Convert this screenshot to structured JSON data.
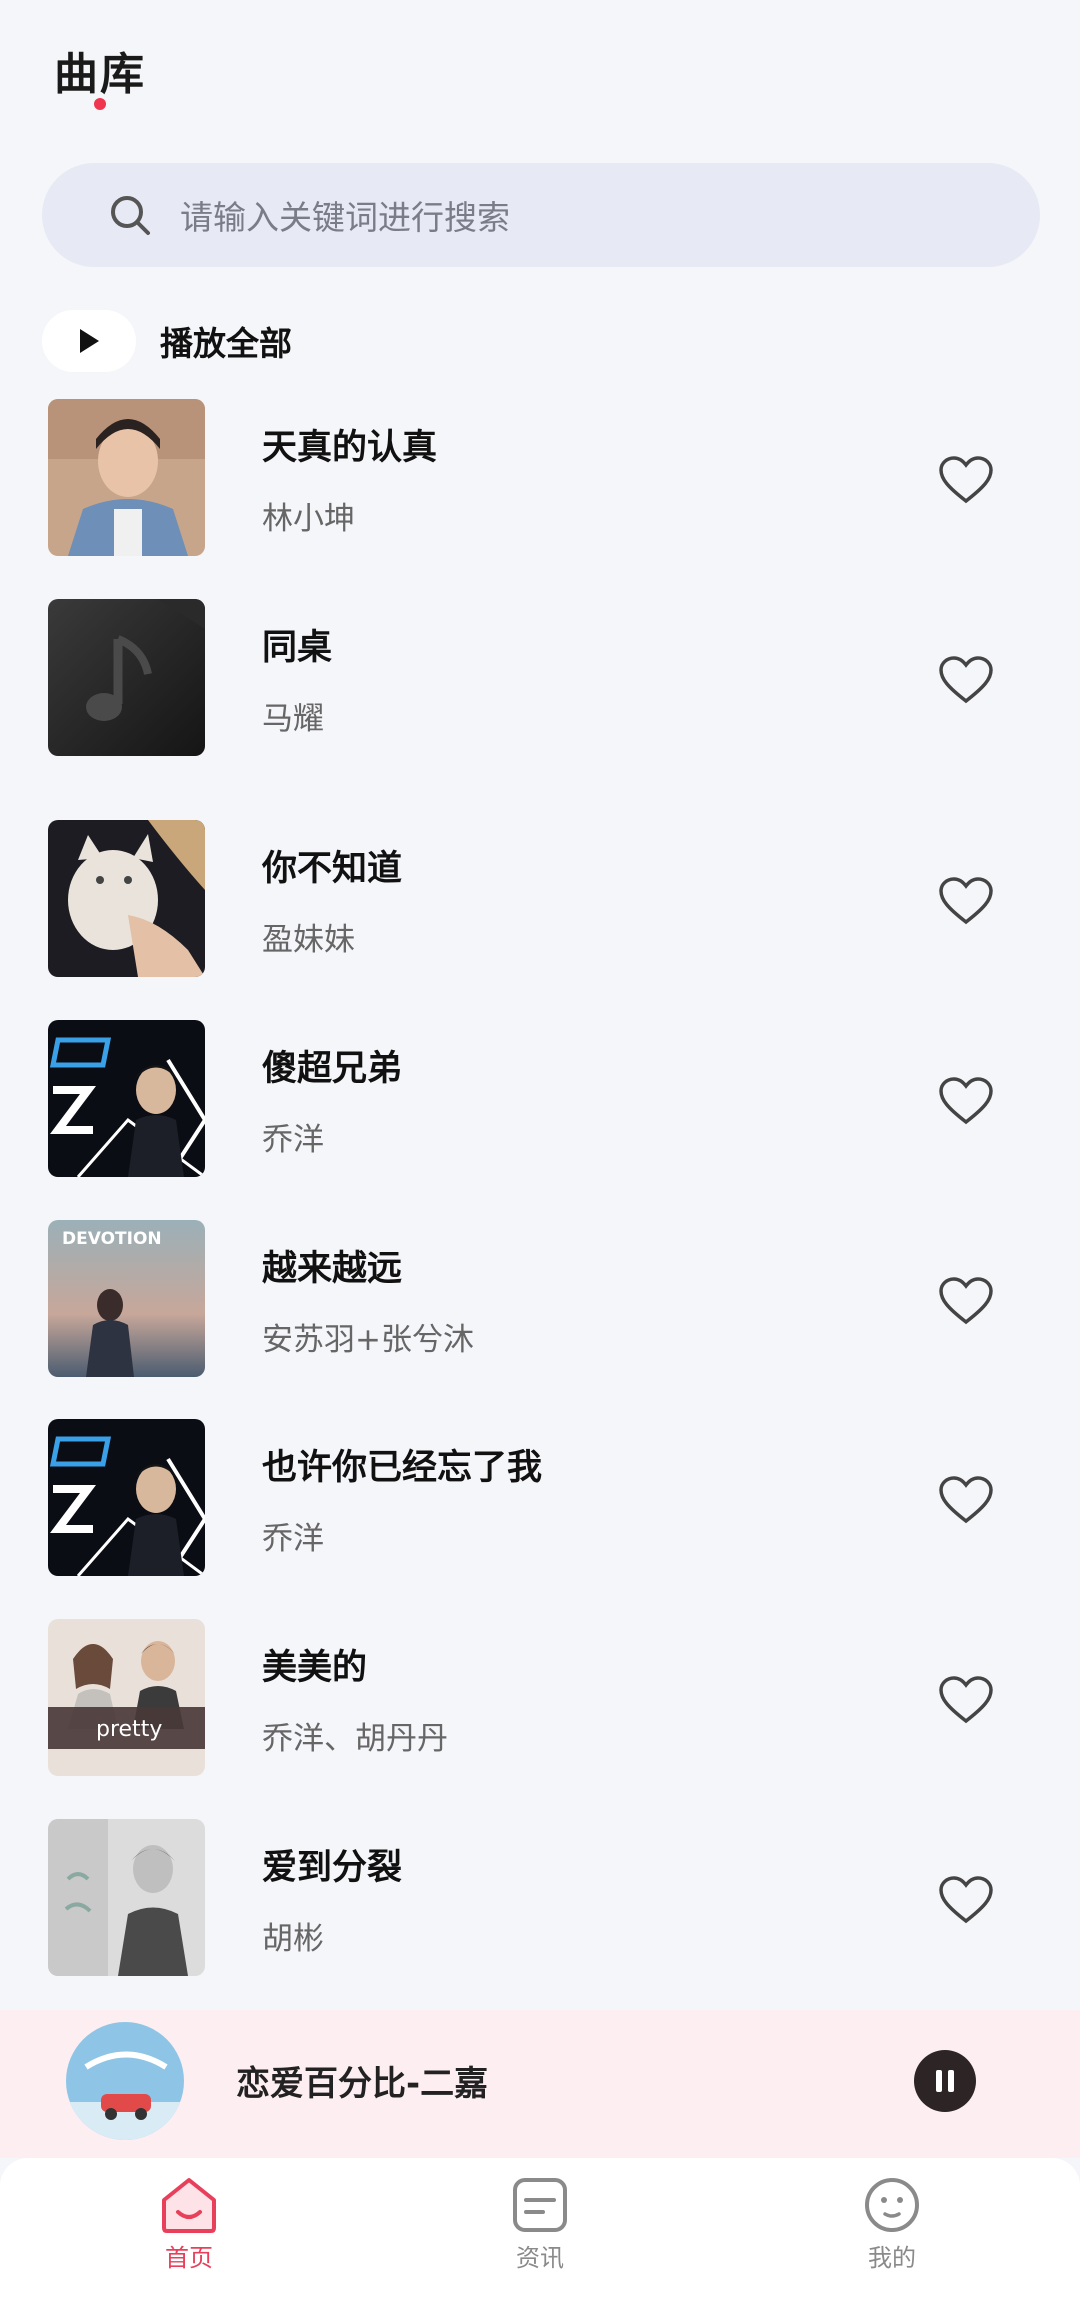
{
  "header": {
    "title": "曲库"
  },
  "search": {
    "placeholder": "请输入关键词进行搜索"
  },
  "play_all": {
    "label": "播放全部"
  },
  "songs": [
    {
      "title": "天真的认真",
      "artist": "林小坤"
    },
    {
      "title": "同桌",
      "artist": "马耀"
    },
    {
      "title": "你不知道",
      "artist": "盈妹妹"
    },
    {
      "title": "傻超兄弟",
      "artist": "乔洋"
    },
    {
      "title": "越来越远",
      "artist": "安苏羽+张兮沐"
    },
    {
      "title": "也许你已经忘了我",
      "artist": "乔洋"
    },
    {
      "title": "美美的",
      "artist": "乔洋、胡丹丹"
    },
    {
      "title": "爱到分裂",
      "artist": "胡彬"
    }
  ],
  "covers": {
    "devotion_text": "DEVOTION",
    "pretty_text": "pretty"
  },
  "now_playing": {
    "title": "恋爱百分比-二嘉"
  },
  "tabs": [
    {
      "label": "首页",
      "icon": "home-icon",
      "active": true
    },
    {
      "label": "资讯",
      "icon": "news-icon",
      "active": false
    },
    {
      "label": "我的",
      "icon": "profile-face-icon",
      "active": false
    }
  ],
  "colors": {
    "accent": "#e8405a",
    "background": "#f5f6fa",
    "search_bg": "#e7e9f4",
    "player_bg": "#fdeef1"
  }
}
